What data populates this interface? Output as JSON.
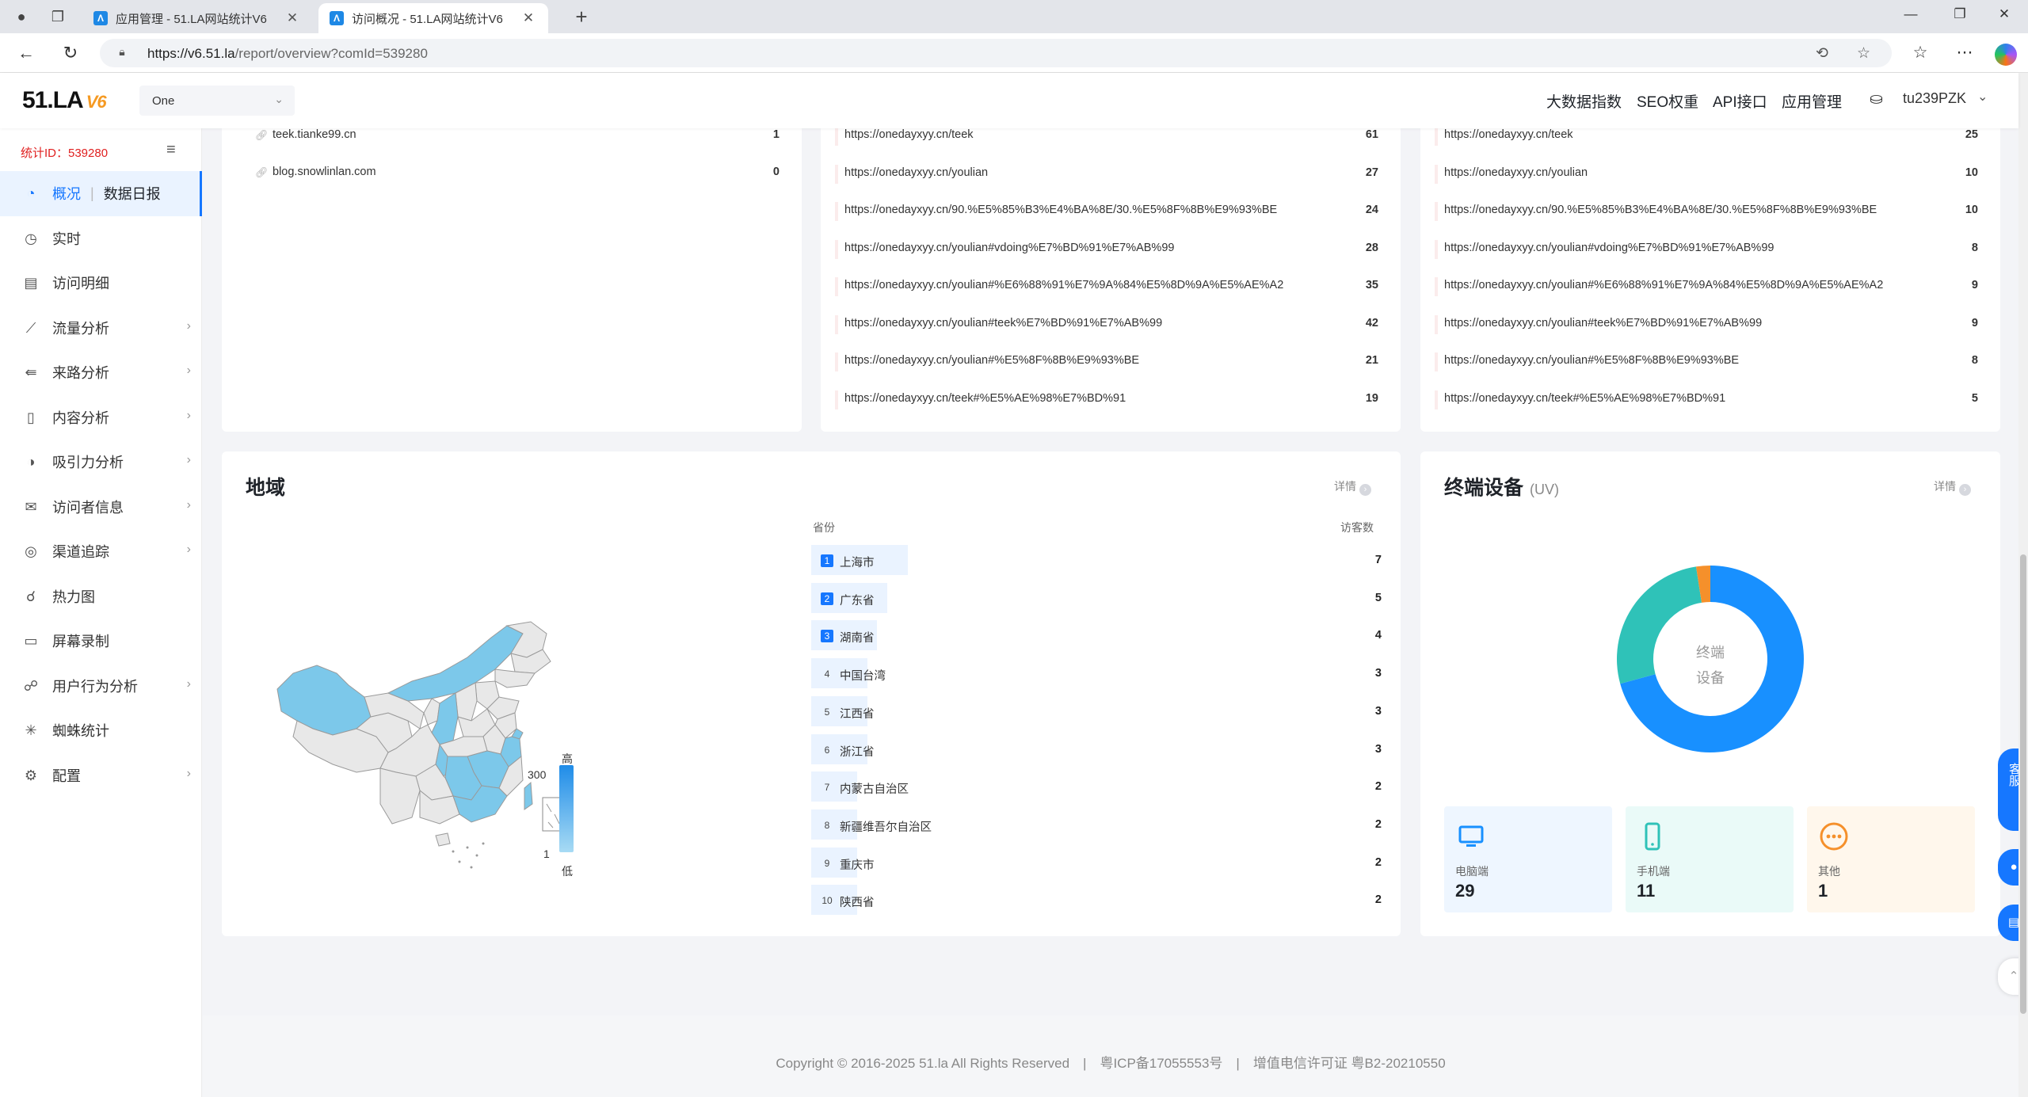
{
  "browser": {
    "tabs": [
      {
        "title": "应用管理 - 51.LA网站统计V6",
        "active": false
      },
      {
        "title": "访问概况 - 51.LA网站统计V6",
        "active": true
      }
    ],
    "url_host": "https://v6.51.la",
    "url_path": "/report/overview?comId=539280"
  },
  "header": {
    "logo": "51.LA",
    "logo_suffix": "V6",
    "site_select": "One",
    "nav": [
      "大数据指数",
      "SEO权重",
      "API接口",
      "应用管理"
    ],
    "username": "tu239PZK"
  },
  "sidebar": {
    "stat_id": "统计ID：539280",
    "items": [
      {
        "label": "概况",
        "sub": "数据日报",
        "icon": "dashboard-icon",
        "active": true,
        "has_children": false
      },
      {
        "label": "实时",
        "icon": "clock-icon",
        "active": false,
        "has_children": false
      },
      {
        "label": "访问明细",
        "icon": "detail-list-icon",
        "active": false,
        "has_children": false
      },
      {
        "label": "流量分析",
        "icon": "traffic-chart-icon",
        "active": false,
        "has_children": true
      },
      {
        "label": "来路分析",
        "icon": "source-icon",
        "active": false,
        "has_children": true
      },
      {
        "label": "内容分析",
        "icon": "document-icon",
        "active": false,
        "has_children": true
      },
      {
        "label": "吸引力分析",
        "icon": "attraction-icon",
        "active": false,
        "has_children": true
      },
      {
        "label": "访问者信息",
        "icon": "mail-icon",
        "active": false,
        "has_children": true
      },
      {
        "label": "渠道追踪",
        "icon": "target-icon",
        "active": false,
        "has_children": true
      },
      {
        "label": "热力图",
        "icon": "heatmap-icon",
        "active": false,
        "has_children": false
      },
      {
        "label": "屏幕录制",
        "icon": "screen-record-icon",
        "active": false,
        "has_children": false
      },
      {
        "label": "用户行为分析",
        "icon": "user-behavior-icon",
        "active": false,
        "has_children": true
      },
      {
        "label": "蜘蛛统计",
        "icon": "spider-icon",
        "active": false,
        "has_children": false
      },
      {
        "label": "配置",
        "icon": "gear-icon",
        "active": false,
        "has_children": true
      }
    ]
  },
  "referrers": [
    {
      "domain": "teek.tianke99.cn",
      "count": "1"
    },
    {
      "domain": "blog.snowlinlan.com",
      "count": "0"
    }
  ],
  "pages_middle": [
    {
      "url": "https://onedayxyy.cn/teek",
      "count": "61"
    },
    {
      "url": "https://onedayxyy.cn/youlian",
      "count": "27"
    },
    {
      "url": "https://onedayxyy.cn/90.%E5%85%B3%E4%BA%8E/30.%E5%8F%8B%E9%93%BE",
      "count": "24"
    },
    {
      "url": "https://onedayxyy.cn/youlian#vdoing%E7%BD%91%E7%AB%99",
      "count": "28"
    },
    {
      "url": "https://onedayxyy.cn/youlian#%E6%88%91%E7%9A%84%E5%8D%9A%E5%AE%A2",
      "count": "35"
    },
    {
      "url": "https://onedayxyy.cn/youlian#teek%E7%BD%91%E7%AB%99",
      "count": "42"
    },
    {
      "url": "https://onedayxyy.cn/youlian#%E5%8F%8B%E9%93%BE",
      "count": "21"
    },
    {
      "url": "https://onedayxyy.cn/teek#%E5%AE%98%E7%BD%91",
      "count": "19"
    }
  ],
  "pages_right": [
    {
      "url": "https://onedayxyy.cn/teek",
      "count": "25"
    },
    {
      "url": "https://onedayxyy.cn/youlian",
      "count": "10"
    },
    {
      "url": "https://onedayxyy.cn/90.%E5%85%B3%E4%BA%8E/30.%E5%8F%8B%E9%93%BE",
      "count": "10"
    },
    {
      "url": "https://onedayxyy.cn/youlian#vdoing%E7%BD%91%E7%AB%99",
      "count": "8"
    },
    {
      "url": "https://onedayxyy.cn/youlian#%E6%88%91%E7%9A%84%E5%8D%9A%E5%AE%A2",
      "count": "9"
    },
    {
      "url": "https://onedayxyy.cn/youlian#teek%E7%BD%91%E7%AB%99",
      "count": "9"
    },
    {
      "url": "https://onedayxyy.cn/youlian#%E5%8F%8B%E9%93%BE",
      "count": "8"
    },
    {
      "url": "https://onedayxyy.cn/teek#%E5%AE%98%E7%BD%91",
      "count": "5"
    }
  ],
  "region": {
    "title": "地域",
    "detail_label": "详情",
    "col_province": "省份",
    "col_visitors": "访客数",
    "legend_high": "高",
    "legend_low": "低",
    "legend_max": "300",
    "legend_min": "1",
    "colors": {
      "filled": "#7cc8ea",
      "empty": "#e8e8e8",
      "rank_top": "#1677ff"
    },
    "rows": [
      {
        "rank": "1",
        "name": "上海市",
        "count": "7"
      },
      {
        "rank": "2",
        "name": "广东省",
        "count": "5"
      },
      {
        "rank": "3",
        "name": "湖南省",
        "count": "4"
      },
      {
        "rank": "4",
        "name": "中国台湾",
        "count": "3"
      },
      {
        "rank": "5",
        "name": "江西省",
        "count": "3"
      },
      {
        "rank": "6",
        "name": "浙江省",
        "count": "3"
      },
      {
        "rank": "7",
        "name": "内蒙古自治区",
        "count": "2"
      },
      {
        "rank": "8",
        "name": "新疆维吾尔自治区",
        "count": "2"
      },
      {
        "rank": "9",
        "name": "重庆市",
        "count": "2"
      },
      {
        "rank": "10",
        "name": "陕西省",
        "count": "2"
      }
    ]
  },
  "devices": {
    "title": "终端设备",
    "unit": "(UV)",
    "detail_label": "详情",
    "donut_center_1": "终端",
    "donut_center_2": "设备",
    "items": [
      {
        "label": "电脑端",
        "value": "29",
        "icon": "desktop-icon",
        "color": "#1890ff",
        "bg": "#eef6ff"
      },
      {
        "label": "手机端",
        "value": "11",
        "icon": "mobile-icon",
        "color": "#2fc2b8",
        "bg": "#eafaf8"
      },
      {
        "label": "其他",
        "value": "1",
        "icon": "other-icon",
        "color": "#f5902b",
        "bg": "#fff7ec"
      }
    ]
  },
  "chart_data": {
    "type": "pie",
    "categories": [
      "电脑端",
      "手机端",
      "其他"
    ],
    "values": [
      29,
      11,
      1
    ],
    "colors": [
      "#1890ff",
      "#2fc2b8",
      "#f5902b"
    ]
  },
  "footer": {
    "text": "Copyright © 2016-2025 51.la All Rights Reserved　|　粤ICP备17055553号　|　增值电信许可证 粤B2-20210550"
  },
  "float_buttons": [
    "客服"
  ]
}
